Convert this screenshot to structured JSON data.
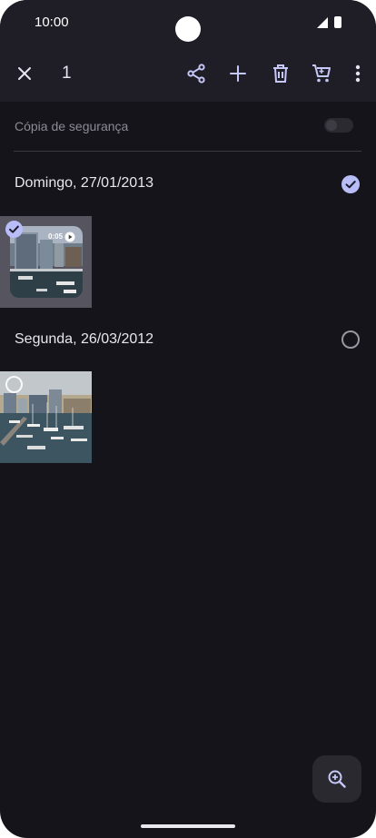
{
  "statusbar": {
    "time": "10:00"
  },
  "toolbar": {
    "selected_count": "1",
    "icons": [
      "close-icon",
      "share-icon",
      "add-icon",
      "delete-icon",
      "cart-icon",
      "more-vert-icon"
    ]
  },
  "backup": {
    "label": "Cópia de segurança",
    "enabled": false
  },
  "groups": [
    {
      "date": "Domingo, 27/01/2013",
      "selected": true,
      "video_duration": "0:05"
    },
    {
      "date": "Segunda, 26/03/2012",
      "selected": false
    }
  ],
  "colors": {
    "accent": "#b9bdf7",
    "background": "#15141a",
    "toolbar": "#1f1e27"
  }
}
